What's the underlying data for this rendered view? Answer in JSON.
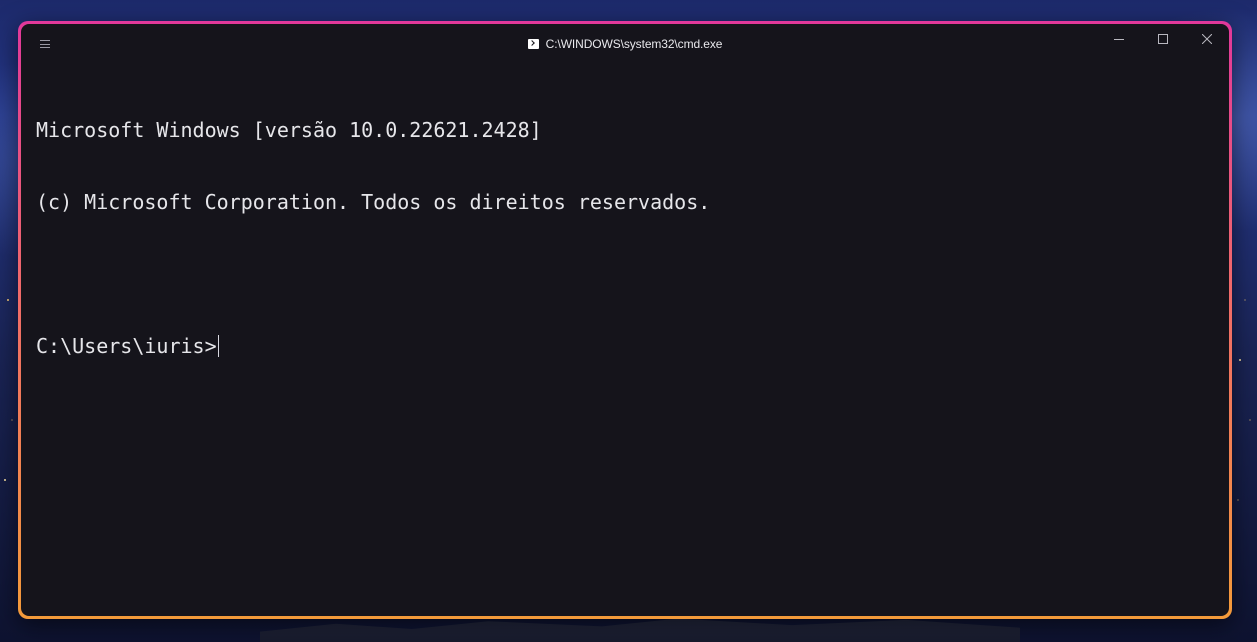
{
  "window": {
    "title": "C:\\WINDOWS\\system32\\cmd.exe",
    "accent_top": "#e1389b",
    "accent_bottom": "#f39a3a",
    "background": "#15141b"
  },
  "titlebar": {
    "menu_icon": "hamburger-icon",
    "app_icon": "command-prompt-icon",
    "buttons": {
      "minimize": "minimize-icon",
      "maximize": "maximize-icon",
      "close": "close-icon"
    }
  },
  "terminal": {
    "lines": [
      "Microsoft Windows [versão 10.0.22621.2428]",
      "(c) Microsoft Corporation. Todos os direitos reservados.",
      ""
    ],
    "prompt": "C:\\Users\\iuris>",
    "input": ""
  }
}
